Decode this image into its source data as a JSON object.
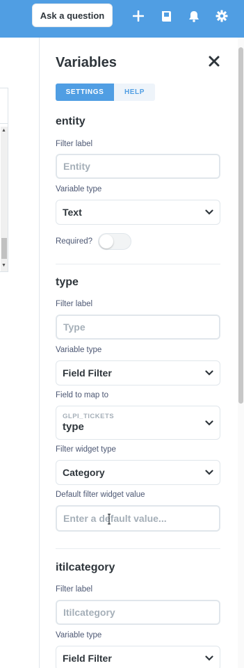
{
  "topbar": {
    "ask_label": "Ask a question",
    "icons": [
      "plus-icon",
      "book-icon",
      "bell-icon",
      "gear-icon"
    ],
    "color": "#509ee3"
  },
  "panel": {
    "title": "Variables",
    "tabs": [
      {
        "label": "SETTINGS",
        "active": true
      },
      {
        "label": "HELP",
        "active": false
      }
    ],
    "variables": [
      {
        "name": "entity",
        "filter_label": "Filter label",
        "filter_placeholder": "Entity",
        "variable_type_label": "Variable type",
        "variable_type": "Text",
        "required_label": "Required?"
      },
      {
        "name": "type",
        "filter_label": "Filter label",
        "filter_placeholder": "Type",
        "variable_type_label": "Variable type",
        "variable_type": "Field Filter",
        "field_map_label": "Field to map to",
        "field_table": "GLPI_TICKETS",
        "field_name": "type",
        "widget_type_label": "Filter widget type",
        "widget_type": "Category",
        "default_label": "Default filter widget value",
        "default_placeholder": "Enter a default value..."
      },
      {
        "name": "itilcategory",
        "filter_label": "Filter label",
        "filter_placeholder": "Itilcategory",
        "variable_type_label": "Variable type",
        "variable_type": "Field Filter"
      }
    ]
  }
}
